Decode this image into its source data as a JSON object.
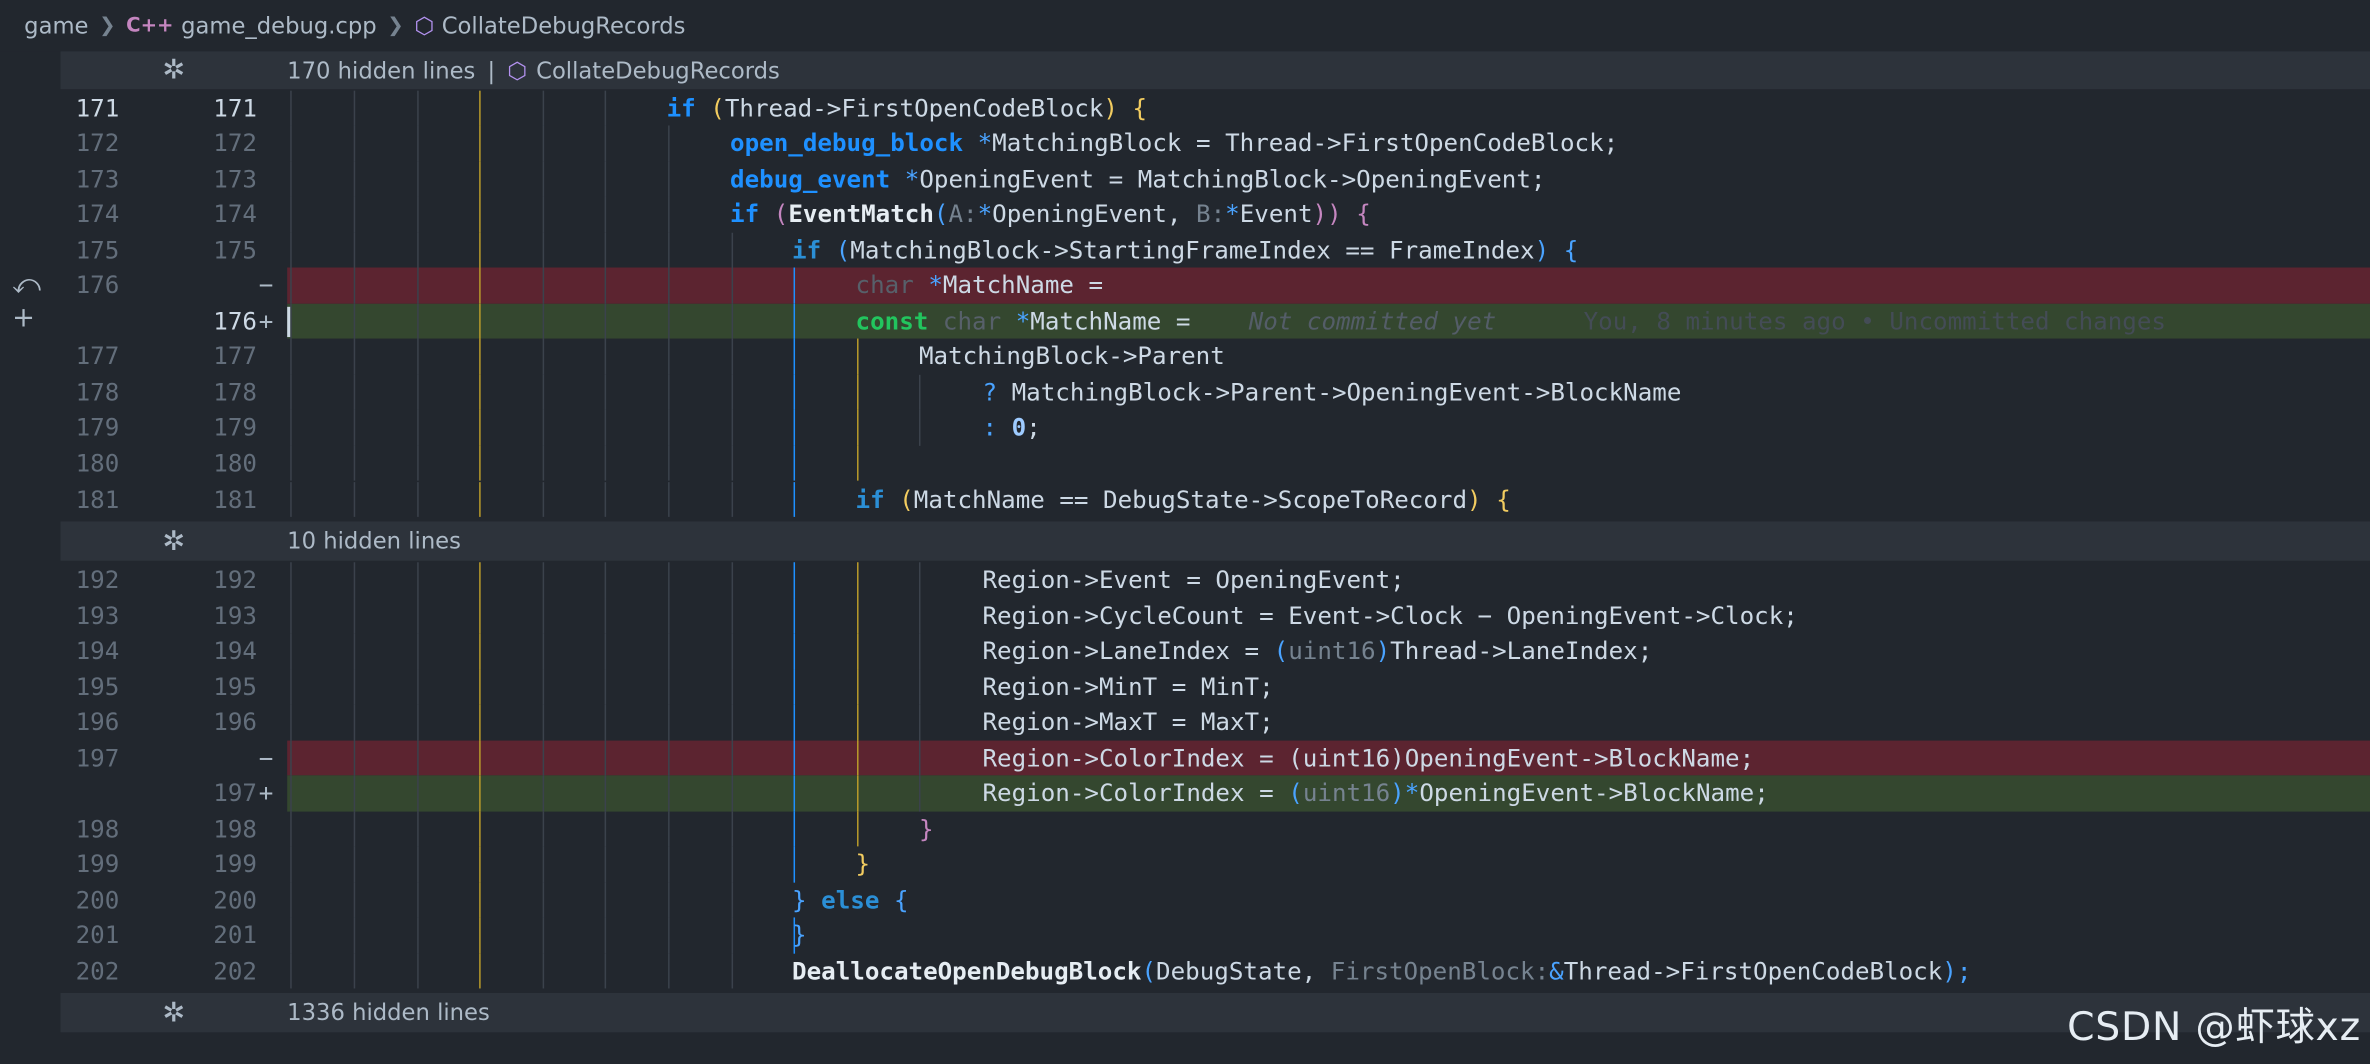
{
  "breadcrumb": {
    "folder": "game",
    "lang_badge": "C++",
    "file": "game_debug.cpp",
    "symbol": "CollateDebugRecords"
  },
  "hidden_bars": [
    {
      "text": "170 hidden lines",
      "separator": "|",
      "symbol": "CollateDebugRecords"
    },
    {
      "text": "10 hidden lines"
    },
    {
      "text": "1336 hidden lines"
    }
  ],
  "inline_blame": {
    "uncommitted": "Not committed yet",
    "info": "You, 8 minutes ago • Uncommitted changes"
  },
  "watermark": "CSDN @虾球xz",
  "lines": [
    {
      "old": "171",
      "new": "171",
      "mark": "",
      "kind": "ctx"
    },
    {
      "old": "172",
      "new": "172",
      "mark": "",
      "kind": "ctx"
    },
    {
      "old": "173",
      "new": "173",
      "mark": "",
      "kind": "ctx"
    },
    {
      "old": "174",
      "new": "174",
      "mark": "",
      "kind": "ctx"
    },
    {
      "old": "175",
      "new": "175",
      "mark": "",
      "kind": "ctx"
    },
    {
      "old": "176",
      "new": "",
      "mark": "−",
      "kind": "del"
    },
    {
      "old": "",
      "new": "176",
      "mark": "+",
      "kind": "add"
    },
    {
      "old": "177",
      "new": "177",
      "mark": "",
      "kind": "ctx"
    },
    {
      "old": "178",
      "new": "178",
      "mark": "",
      "kind": "ctx"
    },
    {
      "old": "179",
      "new": "179",
      "mark": "",
      "kind": "ctx"
    },
    {
      "old": "180",
      "new": "180",
      "mark": "",
      "kind": "ctx"
    },
    {
      "old": "181",
      "new": "181",
      "mark": "",
      "kind": "ctx"
    },
    {
      "old": "192",
      "new": "192",
      "mark": "",
      "kind": "ctx"
    },
    {
      "old": "193",
      "new": "193",
      "mark": "",
      "kind": "ctx"
    },
    {
      "old": "194",
      "new": "194",
      "mark": "",
      "kind": "ctx"
    },
    {
      "old": "195",
      "new": "195",
      "mark": "",
      "kind": "ctx"
    },
    {
      "old": "196",
      "new": "196",
      "mark": "",
      "kind": "ctx"
    },
    {
      "old": "197",
      "new": "",
      "mark": "−",
      "kind": "del"
    },
    {
      "old": "",
      "new": "197",
      "mark": "+",
      "kind": "add"
    },
    {
      "old": "198",
      "new": "198",
      "mark": "",
      "kind": "ctx"
    },
    {
      "old": "199",
      "new": "199",
      "mark": "",
      "kind": "ctx"
    },
    {
      "old": "200",
      "new": "200",
      "mark": "",
      "kind": "ctx"
    },
    {
      "old": "201",
      "new": "201",
      "mark": "",
      "kind": "ctx"
    },
    {
      "old": "202",
      "new": "202",
      "mark": "",
      "kind": "ctx"
    }
  ],
  "code": {
    "l171": {
      "if": "if",
      "p_open": "(",
      "a": "Thread->FirstOpenCodeBlock",
      "p_close": ")",
      "brace": "{"
    },
    "l172": {
      "type": "open_debug_block",
      "star": "*",
      "a": "MatchingBlock = Thread->FirstOpenCodeBlock;"
    },
    "l173": {
      "type": "debug_event",
      "star": "*",
      "a": "OpeningEvent = MatchingBlock->OpeningEvent;"
    },
    "l174": {
      "if": "if",
      "p_open": "(",
      "fn": "EventMatch",
      "paren": "(",
      "hint_a": "A:",
      "star1": "*",
      "a": "OpeningEvent, ",
      "hint_b": "B:",
      "star2": "*",
      "b": "Event",
      "close": "))",
      "brace": "{"
    },
    "l175": {
      "if": "if",
      "p_open": "(",
      "a": "MatchingBlock->StartingFrameIndex == FrameIndex",
      "p_close": ")",
      "brace": "{"
    },
    "l176a": {
      "type": "char",
      "star": "*",
      "a": "MatchName ="
    },
    "l176b": {
      "const": "const",
      "type": "char",
      "star": "*",
      "a": "MatchName ="
    },
    "l177": {
      "a": "MatchingBlock->Parent"
    },
    "l178": {
      "q": "?",
      "a": "MatchingBlock->Parent->OpeningEvent->BlockName"
    },
    "l179": {
      "c": ":",
      "num": "0",
      "semi": ";"
    },
    "l181": {
      "if": "if",
      "p_open": "(",
      "a": "MatchName == DebugState->ScopeToRecord",
      "p_close": ")",
      "brace": "{"
    },
    "l192": {
      "a": "Region->Event = OpeningEvent;"
    },
    "l193": {
      "a": "Region->CycleCount = Event->Clock − OpeningEvent->Clock;"
    },
    "l194": {
      "a": "Region->LaneIndex = ",
      "cast_o": "(",
      "cast": "uint16",
      "cast_c": ")",
      "b": "Thread->LaneIndex;"
    },
    "l195": {
      "a": "Region->MinT = MinT;"
    },
    "l196": {
      "a": "Region->MaxT = MaxT;"
    },
    "l197a": {
      "a": "Region->ColorIndex = (uint16)OpeningEvent->BlockName;"
    },
    "l197b": {
      "a": "Region->ColorIndex = ",
      "cast_o": "(",
      "cast": "uint16",
      "cast_c": ")",
      "star": "*",
      "b": "OpeningEvent->BlockName;"
    },
    "l198": {
      "brace": "}"
    },
    "l199": {
      "brace": "}"
    },
    "l200": {
      "brace": "}",
      "else": "else",
      "brace2": "{"
    },
    "l201": {
      "brace": "}"
    },
    "l202": {
      "fn": "DeallocateOpenDebugBlock",
      "paren": "(",
      "a": "DebugState, ",
      "hint": "FirstOpenBlock:",
      "amp": "&",
      "b": "Thread->FirstOpenCodeBlock",
      "close": ");"
    }
  }
}
